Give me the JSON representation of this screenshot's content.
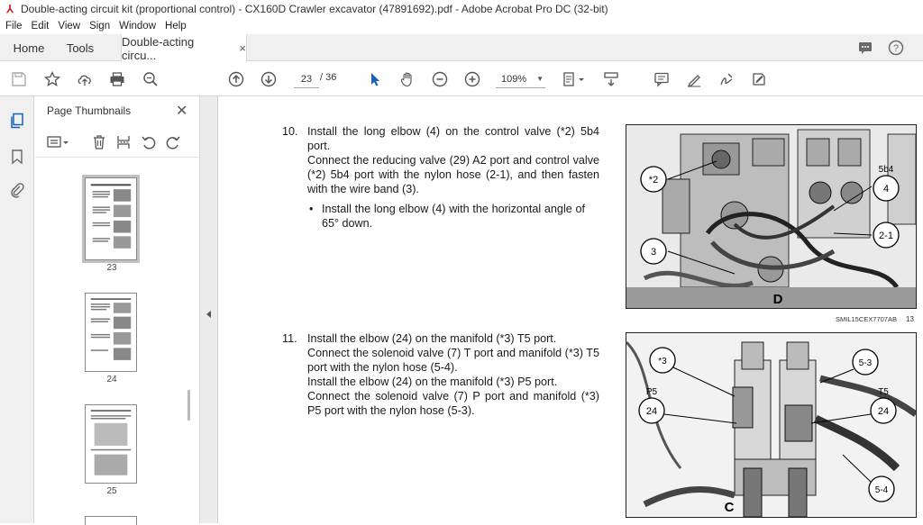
{
  "window": {
    "title": "Double-acting circuit kit (proportional control) - CX160D Crawler excavator (47891692).pdf - Adobe Acrobat Pro DC (32-bit)"
  },
  "menu": [
    "File",
    "Edit",
    "View",
    "Sign",
    "Window",
    "Help"
  ],
  "tabs": {
    "home": "Home",
    "tools": "Tools",
    "document": "Double-acting circu...",
    "close": "×"
  },
  "toolbar": {
    "current_page": "23",
    "total_pages": "/  36",
    "zoom": "109%"
  },
  "thumbnails": {
    "title": "Page Thumbnails",
    "pages": [
      "23",
      "24",
      "25"
    ]
  },
  "content": {
    "step10": {
      "number": "10.",
      "lines": [
        "Install the long elbow (4) on the control valve (*2) 5b4 port.",
        "Connect the reducing valve (29) A2 port and control valve (*2) 5b4 port with the nylon hose (2-1), and then fasten with the wire band (3)."
      ],
      "bullet": "Install the long elbow (4) with the horizontal angle of 65° down."
    },
    "step11": {
      "number": "11.",
      "lines": [
        "Install the elbow (24) on the manifold (*3) T5 port.",
        "Connect the solenoid valve (7) T port and manifold (*3) T5 port with the nylon hose (5-4).",
        "Install the elbow (24) on the manifold (*3) P5 port.",
        "Connect the solenoid valve (7) P port and manifold (*3) P5 port with the nylon hose (5-3)."
      ]
    },
    "figure1": {
      "callouts": [
        "*2",
        "5b4",
        "4",
        "2-1",
        "3",
        "D"
      ],
      "caption": "SMIL15CEX7707AB",
      "page": "13"
    },
    "figure2": {
      "callouts": [
        "*3",
        "5-3",
        "P5",
        "T5",
        "24",
        "24",
        "5-4",
        "C"
      ]
    }
  }
}
